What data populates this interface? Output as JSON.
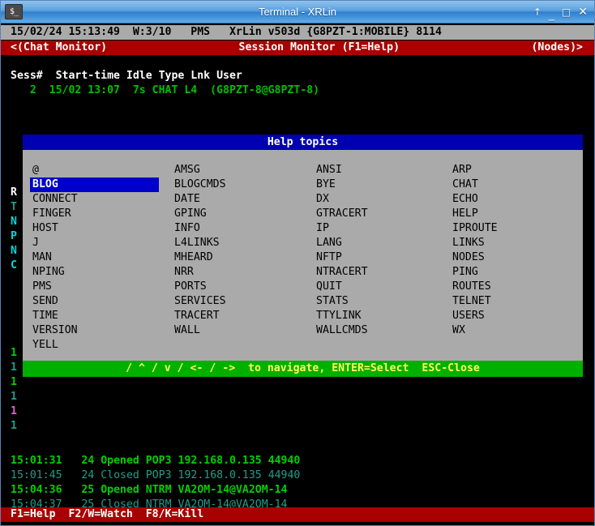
{
  "window": {
    "title": "Terminal - XRLin",
    "icon": "terminal-icon",
    "icon_glyph": "$_",
    "buttons": [
      {
        "name": "shade-button",
        "glyph": "↑"
      },
      {
        "name": "minimize-button",
        "glyph": "_"
      },
      {
        "name": "maximize-button",
        "glyph": "□"
      },
      {
        "name": "close-button",
        "glyph": "✕"
      }
    ]
  },
  "status_line": "15/02/24 15:13:49  W:3/10   PMS   XrLin v503d {G8PZT-1:MOBILE} 8114",
  "monitor_bar": {
    "left": "<(Chat Monitor)",
    "center": "Session Monitor (F1=Help)",
    "right": "(Nodes)>"
  },
  "session_table": {
    "header": "Sess#  Start-time Idle Type Lnk User",
    "rows": [
      "   2  15/02 13:07  7s CHAT L4  (G8PZT-8@G8PZT-8)"
    ]
  },
  "background_margin": [
    {
      "text": "R",
      "color": "white"
    },
    {
      "text": "T",
      "color": "teal"
    },
    {
      "text": "N",
      "color": "cyan"
    },
    {
      "text": "P",
      "color": "cyan"
    },
    {
      "text": "N",
      "color": "cyan"
    },
    {
      "text": "C",
      "color": "cyan"
    },
    {
      "text": "1",
      "color": "green"
    },
    {
      "text": "1",
      "color": "teal"
    },
    {
      "text": "1",
      "color": "green"
    },
    {
      "text": "1",
      "color": "teal"
    },
    {
      "text": "1",
      "color": "magenta"
    },
    {
      "text": "1",
      "color": "teal"
    }
  ],
  "dialog": {
    "title": "Help topics",
    "selected_topic": "BLOG",
    "columns": [
      [
        "@",
        "BLOG",
        "CONNECT",
        "FINGER",
        "HOST",
        "J",
        "MAN",
        "NPING",
        "PMS",
        "SEND",
        "TIME",
        "VERSION",
        "YELL"
      ],
      [
        "AMSG",
        "BLOGCMDS",
        "DATE",
        "GPING",
        "INFO",
        "L4LINKS",
        "MHEARD",
        "NRR",
        "PORTS",
        "SERVICES",
        "TRACERT",
        "WALL",
        ""
      ],
      [
        "ANSI",
        "BYE",
        "DX",
        "GTRACERT",
        "IP",
        "LANG",
        "NFTP",
        "NTRACERT",
        "QUIT",
        "STATS",
        "TTYLINK",
        "WALLCMDS",
        ""
      ],
      [
        "ARP",
        "CHAT",
        "ECHO",
        "HELP",
        "IPROUTE",
        "LINKS",
        "NODES",
        "PING",
        "ROUTES",
        "TELNET",
        "USERS",
        "WX",
        ""
      ]
    ],
    "navbar": "/ ^ / v / <- / ->  to navigate, ENTER=Select  ESC-Close"
  },
  "log_lines": [
    {
      "time": "15:01:31",
      "sess": "24",
      "action": "Opened",
      "proto": "POP3",
      "peer": "192.168.0.135 44940",
      "style": "bright"
    },
    {
      "time": "15:01:45",
      "sess": "24",
      "action": "Closed",
      "proto": "POP3",
      "peer": "192.168.0.135 44940",
      "style": "dim"
    },
    {
      "time": "15:04:36",
      "sess": "25",
      "action": "Opened",
      "proto": "NTRM",
      "peer": "VA2OM-14@VA2OM-14",
      "style": "bright"
    },
    {
      "time": "15:04:37",
      "sess": "25",
      "action": "Closed",
      "proto": "NTRM",
      "peer": "VA2OM-14@VA2OM-14",
      "style": "dim"
    }
  ],
  "key_bar": "F1=Help  F2/W=Watch  F8/K=Kill",
  "colors": {
    "title_gradient_top": "#8fc2ee",
    "title_gradient_bottom": "#62abe6",
    "status_bg": "#aaaaaa",
    "red_bar": "#a80000",
    "dialog_title_bg": "#0000b0",
    "dialog_body_bg": "#aaaaaa",
    "selection_bg": "#0000cc",
    "navbar_bg": "#00b000",
    "navbar_fg": "#ffff55",
    "terminal_bg": "#000000",
    "green_text": "#00d000",
    "dim_text": "#1f9e8c"
  }
}
